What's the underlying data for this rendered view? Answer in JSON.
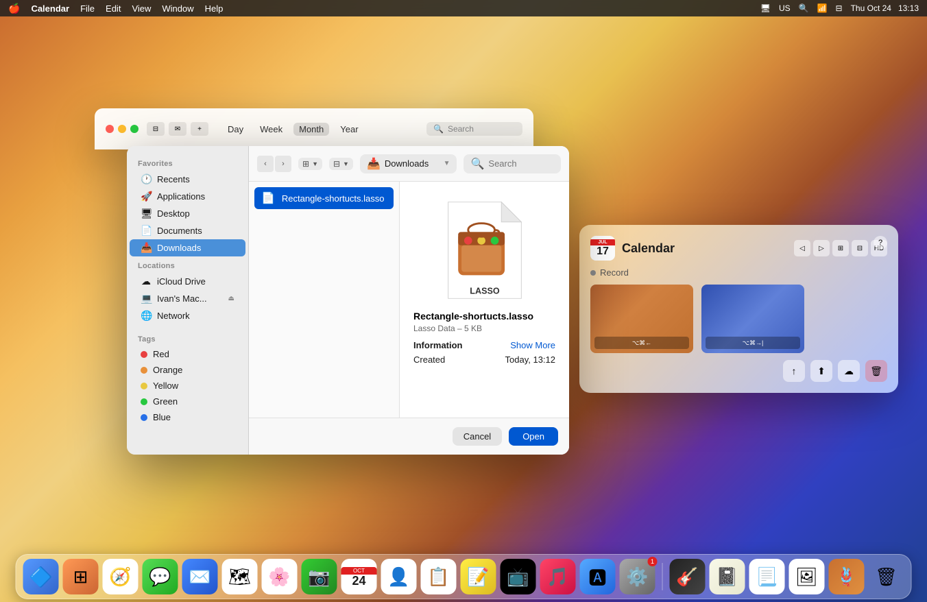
{
  "menubar": {
    "apple": "🍎",
    "app_name": "Calendar",
    "menus": [
      "File",
      "Edit",
      "View",
      "Window",
      "Help"
    ],
    "right_items": [
      "US",
      "Thu Oct 24",
      "13:13"
    ],
    "icons": [
      "search",
      "wifi",
      "control-center"
    ]
  },
  "calendar_toolbar": {
    "views": [
      "Day",
      "Week",
      "Month",
      "Year"
    ],
    "active_view": "Month",
    "search_placeholder": "Search"
  },
  "finder": {
    "toolbar": {
      "location_name": "Downloads",
      "location_icon": "📥",
      "search_placeholder": "Search",
      "view_icons": [
        "⊞",
        "⊟"
      ]
    },
    "sidebar": {
      "favorites_title": "Favorites",
      "favorites": [
        {
          "label": "Recents",
          "icon": "🕐",
          "active": false
        },
        {
          "label": "Applications",
          "icon": "🚀",
          "active": false
        },
        {
          "label": "Desktop",
          "icon": "🖥",
          "active": false
        },
        {
          "label": "Documents",
          "icon": "📄",
          "active": false
        },
        {
          "label": "Downloads",
          "icon": "📥",
          "active": true
        }
      ],
      "locations_title": "Locations",
      "locations": [
        {
          "label": "iCloud Drive",
          "icon": "☁",
          "active": false
        },
        {
          "label": "Ivan's Mac...",
          "icon": "💻",
          "active": false
        },
        {
          "label": "Network",
          "icon": "🌐",
          "active": false
        }
      ],
      "tags_title": "Tags",
      "tags": [
        {
          "label": "Red",
          "color": "#e84040"
        },
        {
          "label": "Orange",
          "color": "#e8903a"
        },
        {
          "label": "Yellow",
          "color": "#e8c840"
        },
        {
          "label": "Green",
          "color": "#28c840"
        },
        {
          "label": "Blue",
          "color": "#2870e8"
        }
      ]
    },
    "selected_file": {
      "name": "Rectangle-shortucts.lasso",
      "type_label": "Lasso Data",
      "size": "5 KB",
      "info_label": "Information",
      "show_more": "Show More",
      "created_label": "Created",
      "created_value": "Today, 13:12"
    },
    "buttons": {
      "cancel": "Cancel",
      "open": "Open"
    }
  },
  "calendar_widget": {
    "month_abbr": "JUL",
    "date": "17",
    "title": "Calendar",
    "record_label": "Record",
    "question_mark": "?",
    "actions": [
      "share",
      "share2",
      "cloud",
      "trash"
    ],
    "thumb1_label": "⌥⌘←",
    "thumb2_label": "⌥⌘→|"
  },
  "dock": {
    "items": [
      {
        "name": "finder",
        "icon": "🔷",
        "label": "Finder"
      },
      {
        "name": "launchpad",
        "icon": "🟢",
        "label": "Launchpad"
      },
      {
        "name": "safari",
        "icon": "🧭",
        "label": "Safari"
      },
      {
        "name": "messages",
        "icon": "💬",
        "label": "Messages"
      },
      {
        "name": "mail",
        "icon": "✉️",
        "label": "Mail"
      },
      {
        "name": "maps",
        "icon": "🗺",
        "label": "Maps"
      },
      {
        "name": "photos",
        "icon": "🌸",
        "label": "Photos"
      },
      {
        "name": "facetime",
        "icon": "📷",
        "label": "FaceTime"
      },
      {
        "name": "calendar",
        "icon": "📅",
        "label": "Calendar"
      },
      {
        "name": "contacts",
        "icon": "👤",
        "label": "Contacts"
      },
      {
        "name": "reminders",
        "icon": "📋",
        "label": "Reminders"
      },
      {
        "name": "notes",
        "icon": "📝",
        "label": "Notes"
      },
      {
        "name": "tv",
        "icon": "📺",
        "label": "TV"
      },
      {
        "name": "music",
        "icon": "🎵",
        "label": "Music"
      },
      {
        "name": "appstore",
        "icon": "🅰",
        "label": "App Store"
      },
      {
        "name": "systemprefs",
        "icon": "⚙️",
        "label": "System Preferences"
      },
      {
        "name": "instrument",
        "icon": "🎸",
        "label": "Instrument"
      },
      {
        "name": "notepad2",
        "icon": "📓",
        "label": "Notepad"
      },
      {
        "name": "textedit",
        "icon": "📃",
        "label": "TextEdit"
      },
      {
        "name": "finder2",
        "icon": "🖼",
        "label": "Finder"
      },
      {
        "name": "lasso",
        "icon": "🎯",
        "label": "Lasso"
      },
      {
        "name": "trash",
        "icon": "🗑",
        "label": "Trash"
      }
    ]
  }
}
